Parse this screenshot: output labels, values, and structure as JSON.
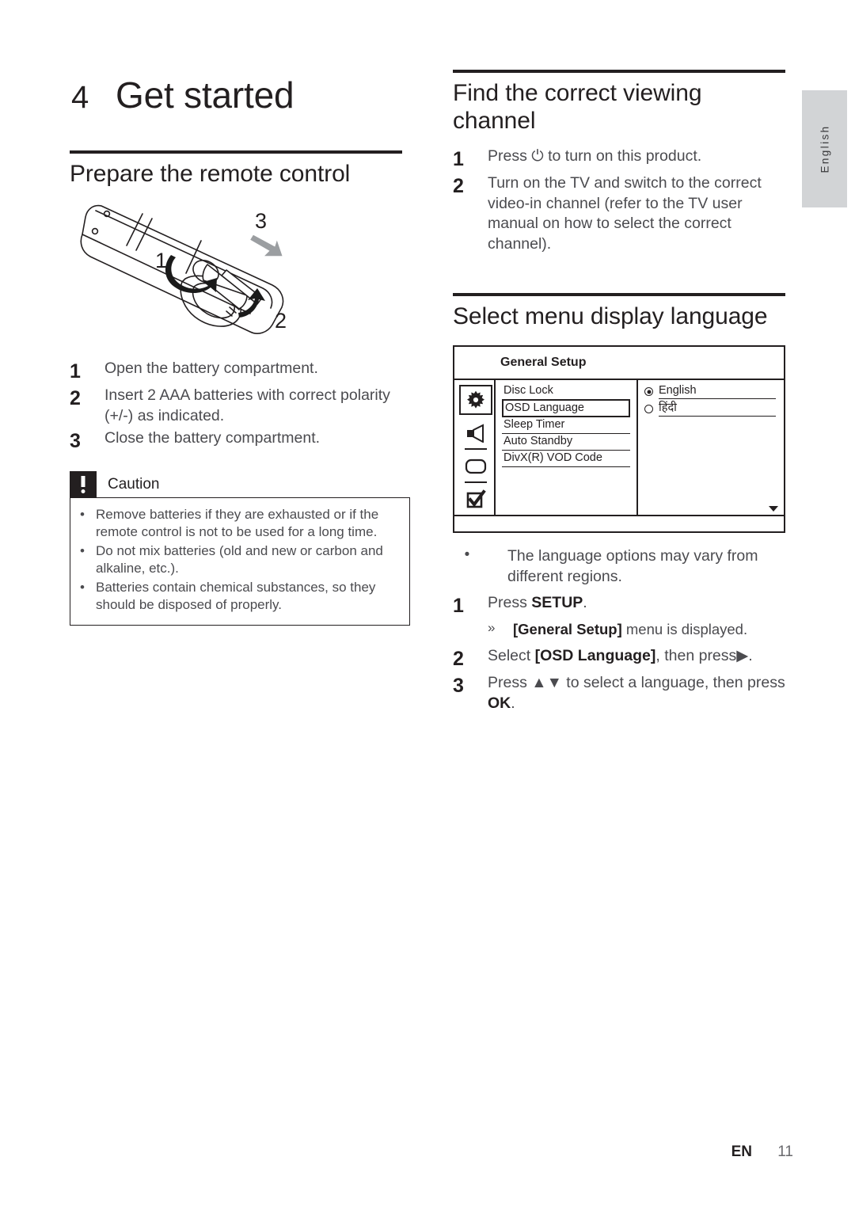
{
  "sidebar_tab": {
    "label": "English"
  },
  "chapter": {
    "number": "4",
    "title": "Get started"
  },
  "left": {
    "section_title": "Prepare the remote control",
    "illustration": {
      "name": "remote-control-battery-diagram",
      "callouts": [
        "1",
        "2",
        "3"
      ]
    },
    "steps": [
      {
        "n": "1",
        "text": "Open the battery compartment."
      },
      {
        "n": "2",
        "text": "Insert 2 AAA batteries with correct polarity (+/-) as indicated."
      },
      {
        "n": "3",
        "text": "Close the battery compartment."
      }
    ],
    "caution": {
      "icon": "exclamation-icon",
      "title": "Caution",
      "bullet": "•",
      "items": [
        "Remove batteries if they are exhausted or if the remote control is not to be used for a long time.",
        "Do not mix batteries (old and new or carbon and alkaline, etc.).",
        "Batteries contain chemical substances, so they should be disposed of properly."
      ]
    }
  },
  "right": {
    "section1_title": "Find the correct viewing channel",
    "section1_steps": [
      {
        "n": "1",
        "text_before": "Press ",
        "symbol": "⏻",
        "text_after": " to turn on this product."
      },
      {
        "n": "2",
        "text": "Turn on the TV and switch to the correct video-in channel (refer to the TV user manual on how to select the correct channel)."
      }
    ],
    "section2_title": "Select menu display language",
    "osd": {
      "header": "General Setup",
      "icons": [
        {
          "name": "gear-icon",
          "selected": true
        },
        {
          "name": "speaker-icon",
          "selected": false
        },
        {
          "name": "video-screen-icon",
          "selected": false
        },
        {
          "name": "checkbox-checked-icon",
          "selected": false
        }
      ],
      "menu_items": [
        {
          "label": "Disc Lock",
          "selected": false
        },
        {
          "label": "OSD Language",
          "selected": true
        },
        {
          "label": "Sleep Timer",
          "selected": false
        },
        {
          "label": "Auto Standby",
          "selected": false
        },
        {
          "label": "DivX(R) VOD Code",
          "selected": false
        }
      ],
      "options": [
        {
          "label": "English",
          "selected": true
        },
        {
          "label": "हिंदी",
          "selected": false
        }
      ],
      "scroll_indicator": "chevron-down-icon"
    },
    "note": {
      "bullet": "•",
      "text": "The language options may vary from different regions."
    },
    "steps": [
      {
        "n": "1",
        "text_before": "Press ",
        "bold": "SETUP",
        "text_after": "."
      },
      {
        "n": "2",
        "text_before": "Select ",
        "bold": "[OSD Language]",
        "text_after": ", then press▶."
      },
      {
        "n": "3",
        "text_before": "Press ▲▼ to select a language, then press ",
        "bold": "OK",
        "text_after": "."
      }
    ],
    "sub_step": {
      "marker": "»",
      "bold": "[General Setup]",
      "text_after": " menu is displayed."
    }
  },
  "footer": {
    "language_code": "EN",
    "page_number": "11"
  }
}
